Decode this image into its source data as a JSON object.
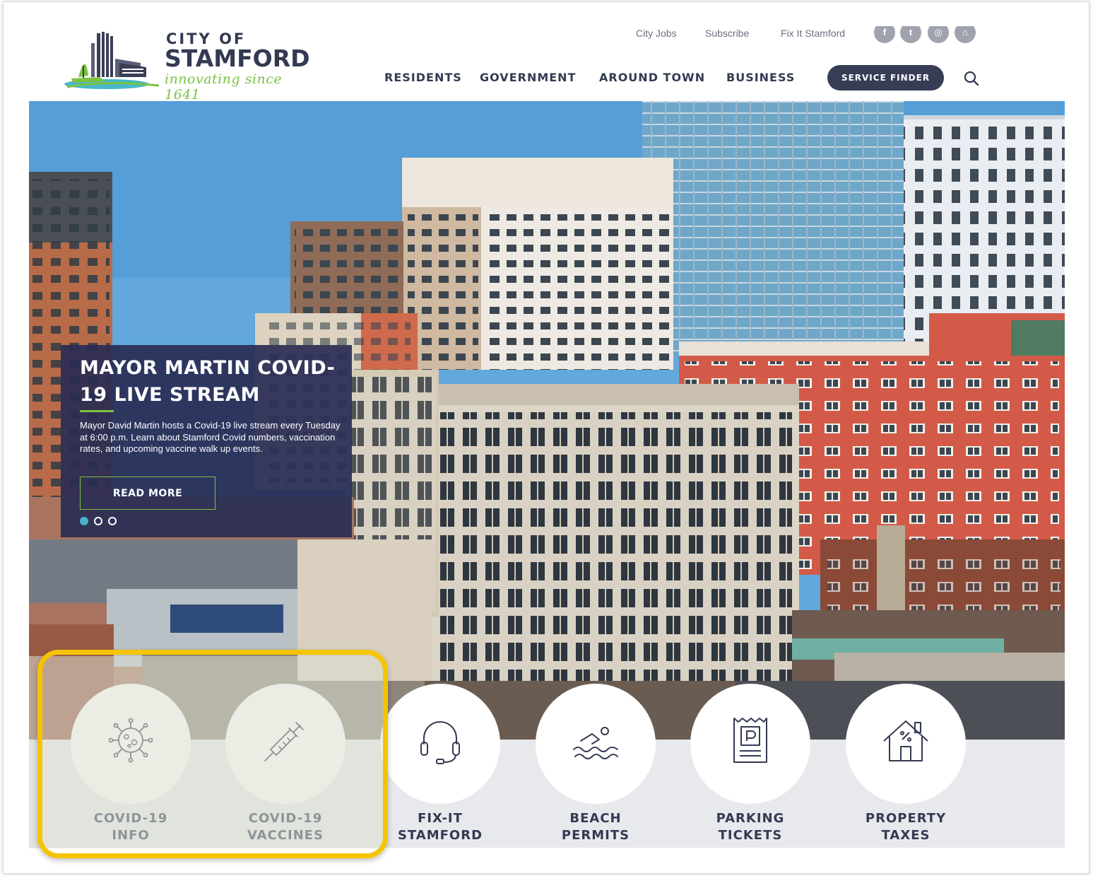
{
  "site": {
    "logo": {
      "line1": "CITY OF",
      "line2": "STAMFORD",
      "tagline": "innovating since 1641"
    }
  },
  "utility_links": [
    {
      "label": "City Jobs"
    },
    {
      "label": "Subscribe"
    },
    {
      "label": "Fix It Stamford"
    }
  ],
  "social_icons": [
    {
      "icon": "facebook-icon",
      "glyph": "f"
    },
    {
      "icon": "twitter-icon",
      "glyph": "t"
    },
    {
      "icon": "instagram-icon",
      "glyph": "◎"
    },
    {
      "icon": "home-icon",
      "glyph": "⌂"
    }
  ],
  "nav": {
    "items": [
      {
        "label": "RESIDENTS"
      },
      {
        "label": "GOVERNMENT"
      },
      {
        "label": "AROUND TOWN"
      },
      {
        "label": "BUSINESS"
      }
    ],
    "service_finder": "SERVICE FINDER"
  },
  "hero": {
    "title": "MAYOR MARTIN COVID-19 LIVE STREAM",
    "body": "Mayor David Martin hosts a Covid-19 live stream every Tuesday at 6:00 p.m. Learn about Stamford Covid numbers, vaccination rates, and upcoming vaccine walk up events.",
    "button": "READ MORE",
    "slides_total": 3,
    "slide_active": 1
  },
  "quick_links": [
    {
      "line1": "COVID-19",
      "line2": "INFO",
      "icon": "virus-icon"
    },
    {
      "line1": "COVID-19",
      "line2": "VACCINES",
      "icon": "syringe-icon"
    },
    {
      "line1": "FIX-IT",
      "line2": "STAMFORD",
      "icon": "headset-icon"
    },
    {
      "line1": "BEACH",
      "line2": "PERMITS",
      "icon": "swimmer-icon"
    },
    {
      "line1": "PARKING",
      "line2": "TICKETS",
      "icon": "parking-ticket-icon"
    },
    {
      "line1": "PROPERTY",
      "line2": "TAXES",
      "icon": "house-icon"
    }
  ],
  "colors": {
    "navy": "#333a52",
    "accent_green": "#7cc243",
    "highlight": "#f5c400"
  }
}
